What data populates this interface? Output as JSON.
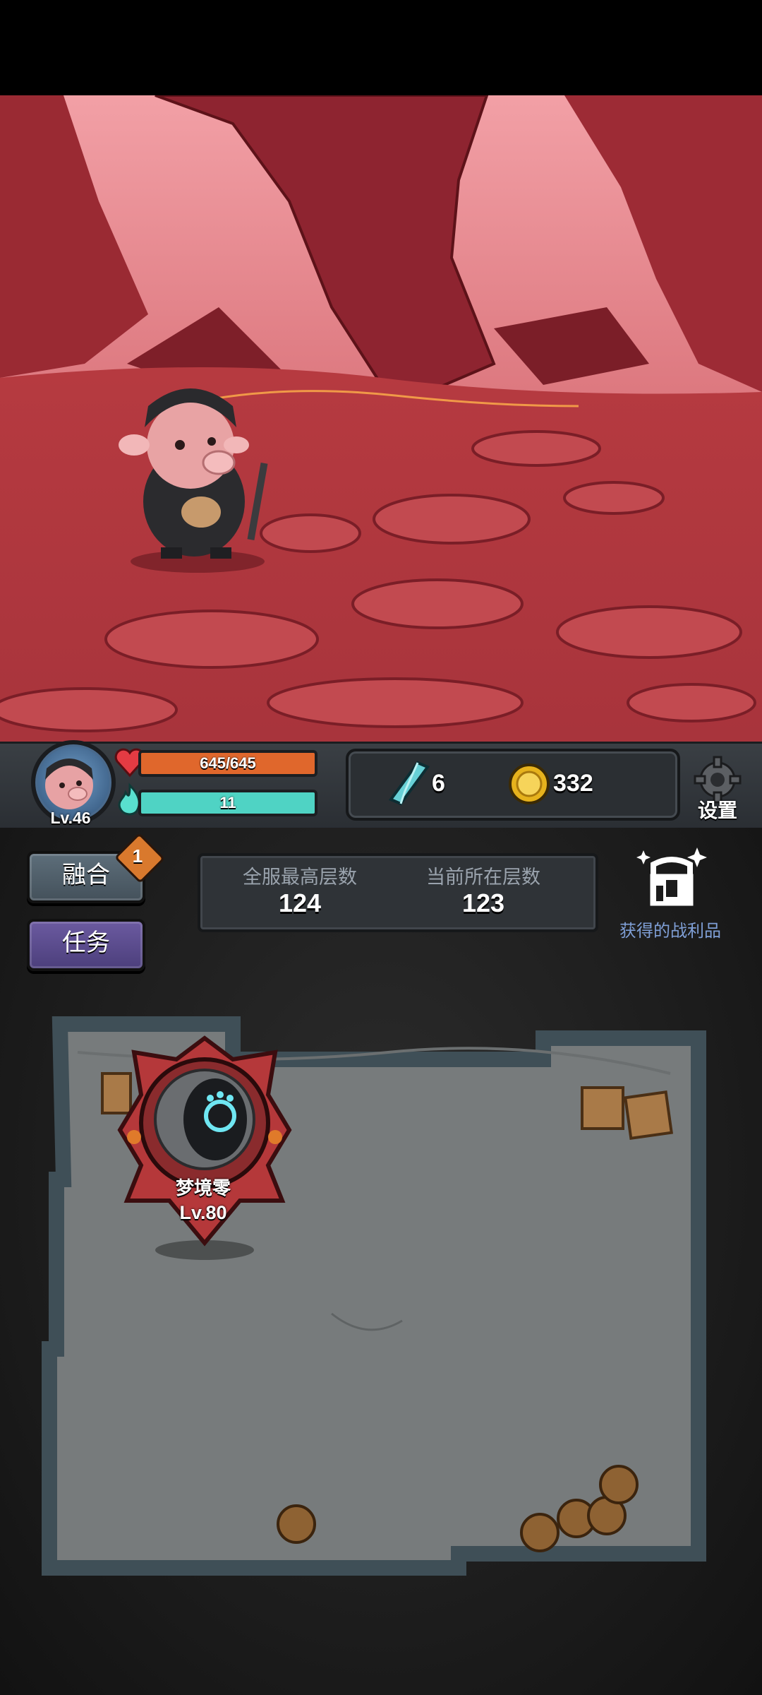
{
  "player": {
    "level_label": "Lv.46",
    "hp_text": "645/645",
    "hp_fraction": 1.0,
    "mana_text": "11",
    "mana_fraction": 1.0
  },
  "resources": {
    "crystals": "6",
    "coins": "332"
  },
  "settings": {
    "label": "设置"
  },
  "side_buttons": {
    "fuse_label": "融合",
    "fuse_badge": "1",
    "task_label": "任务"
  },
  "floors": {
    "server_best_label": "全服最高层数",
    "server_best_value": "124",
    "current_label": "当前所在层数",
    "current_value": "123"
  },
  "loot": {
    "label": "获得的战利品"
  },
  "boss": {
    "name": "梦境零",
    "level_label": "Lv.80"
  },
  "colors": {
    "hp": "#e0672c",
    "mana": "#4fd3c4",
    "task_button": "#5a4a90",
    "fuse_button": "#52616c",
    "loot_text": "#7f9fd6"
  }
}
